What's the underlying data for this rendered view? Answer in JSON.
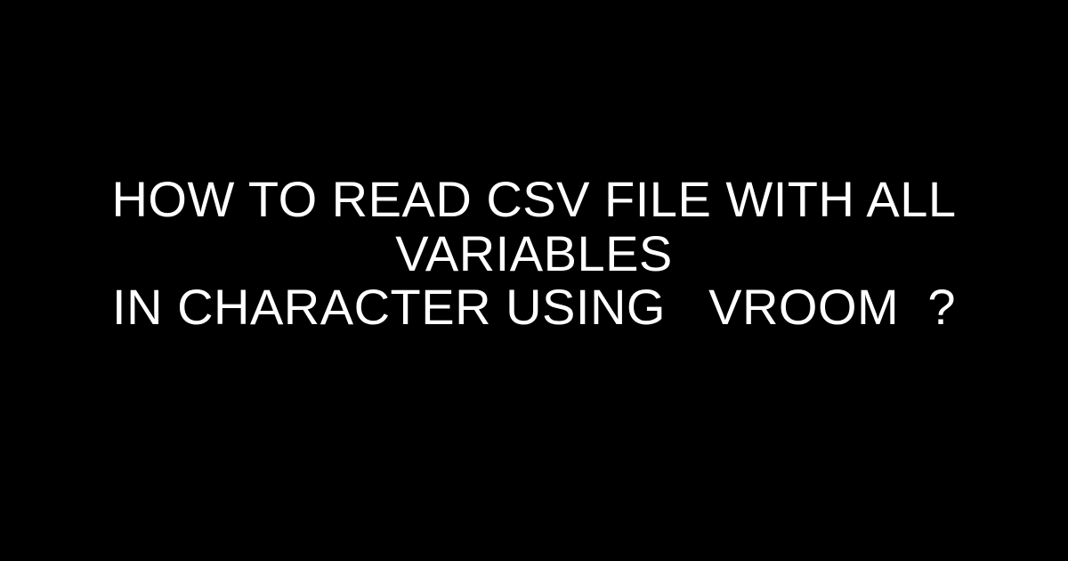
{
  "title": {
    "line1": "HOW TO READ CSV FILE WITH ALL VARIABLES",
    "line2_part1": "IN CHARACTER USING ",
    "line2_code": "VROOM",
    "line2_part2": "?"
  }
}
